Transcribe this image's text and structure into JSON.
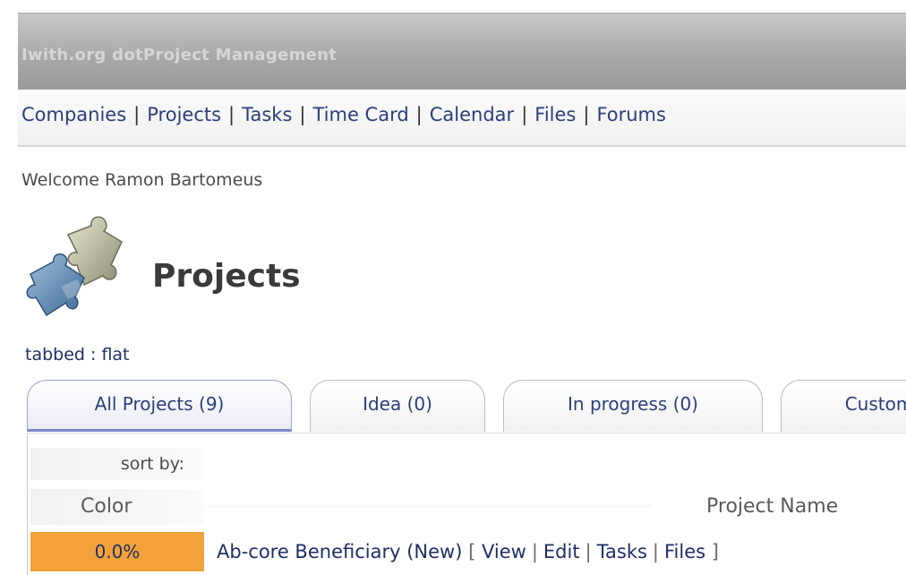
{
  "app": {
    "title": "Iwith.org dotProject Management"
  },
  "nav": {
    "items": [
      "Companies",
      "Projects",
      "Tasks",
      "Time Card",
      "Calendar",
      "Files",
      "Forums"
    ],
    "separator": "|"
  },
  "welcome_text": "Welcome Ramon Bartomeus",
  "page": {
    "icon": "puzzle-icon",
    "title": "Projects",
    "view_mode": "tabbed : flat"
  },
  "tabs": [
    {
      "label": "All Projects (9)",
      "active": true
    },
    {
      "label": "Idea (0)",
      "active": false
    },
    {
      "label": "In progress (0)",
      "active": false
    },
    {
      "label": "Custom",
      "active": false
    }
  ],
  "table": {
    "sort_by_label": "sort by:",
    "columns": [
      "Color",
      "Project Name"
    ],
    "rows": [
      {
        "progress": "0.0%",
        "color": "#f3a23a",
        "name": "Ab-core Beneficiary (New)",
        "bracket_open": "[",
        "actions": [
          "View",
          "Edit",
          "Tasks",
          "Files"
        ],
        "bracket_close": "]"
      }
    ]
  },
  "colors": {
    "link": "#2b3f7a",
    "titlebar": "#a9a9a9",
    "progress": "#f3a23a",
    "tab_active_underline": "#7c86c8"
  }
}
